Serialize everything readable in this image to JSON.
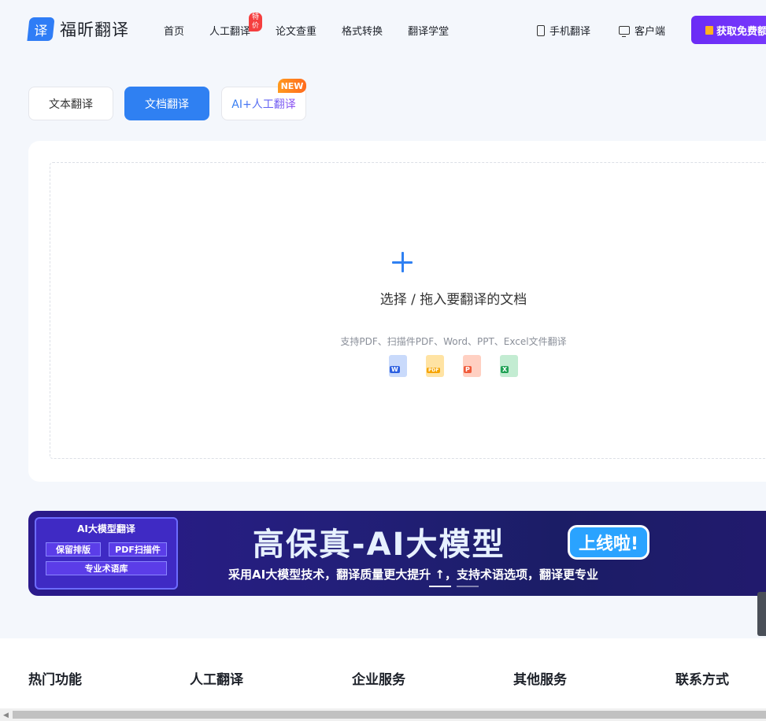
{
  "header": {
    "logo_mark": "译",
    "brand": "福昕翻译",
    "nav": [
      {
        "label": "首页"
      },
      {
        "label": "人工翻译",
        "badge": "特价"
      },
      {
        "label": "论文查重"
      },
      {
        "label": "格式转换"
      },
      {
        "label": "翻译学堂"
      }
    ],
    "mobile": "手机翻译",
    "client": "客户端",
    "cta": "获取免费额"
  },
  "tabs": {
    "text": "文本翻译",
    "doc": "文档翻译",
    "ai": "AI+人工翻译",
    "new_badge": "NEW"
  },
  "upload": {
    "title": "选择 / 拖入要翻译的文档",
    "subtitle": "支持PDF、扫描件PDF、Word、PPT、Excel文件翻译",
    "file_types": [
      {
        "label": "W",
        "icon": "word-file-icon"
      },
      {
        "label": "PDF",
        "icon": "pdf-file-icon"
      },
      {
        "label": "P",
        "icon": "ppt-file-icon"
      },
      {
        "label": "X",
        "icon": "excel-file-icon"
      }
    ]
  },
  "banner": {
    "box_title": "AI大模型翻译",
    "chip1": "保留排版",
    "chip2": "PDF扫描件",
    "chip3": "专业术语库",
    "headline": "高保真-AI大模型",
    "pill": "上线啦!",
    "sub": "采用AI大模型技术，翻译质量更大提升 ↑，支持术语选项，翻译更专业"
  },
  "footer": {
    "cols": [
      "热门功能",
      "人工翻译",
      "企业服务",
      "其他服务",
      "联系方式"
    ]
  },
  "colors": {
    "primary": "#2f80f2",
    "cta": "#6b2cf5",
    "badge_red": "#f53f3f",
    "new_orange": "#ff8a1e"
  }
}
